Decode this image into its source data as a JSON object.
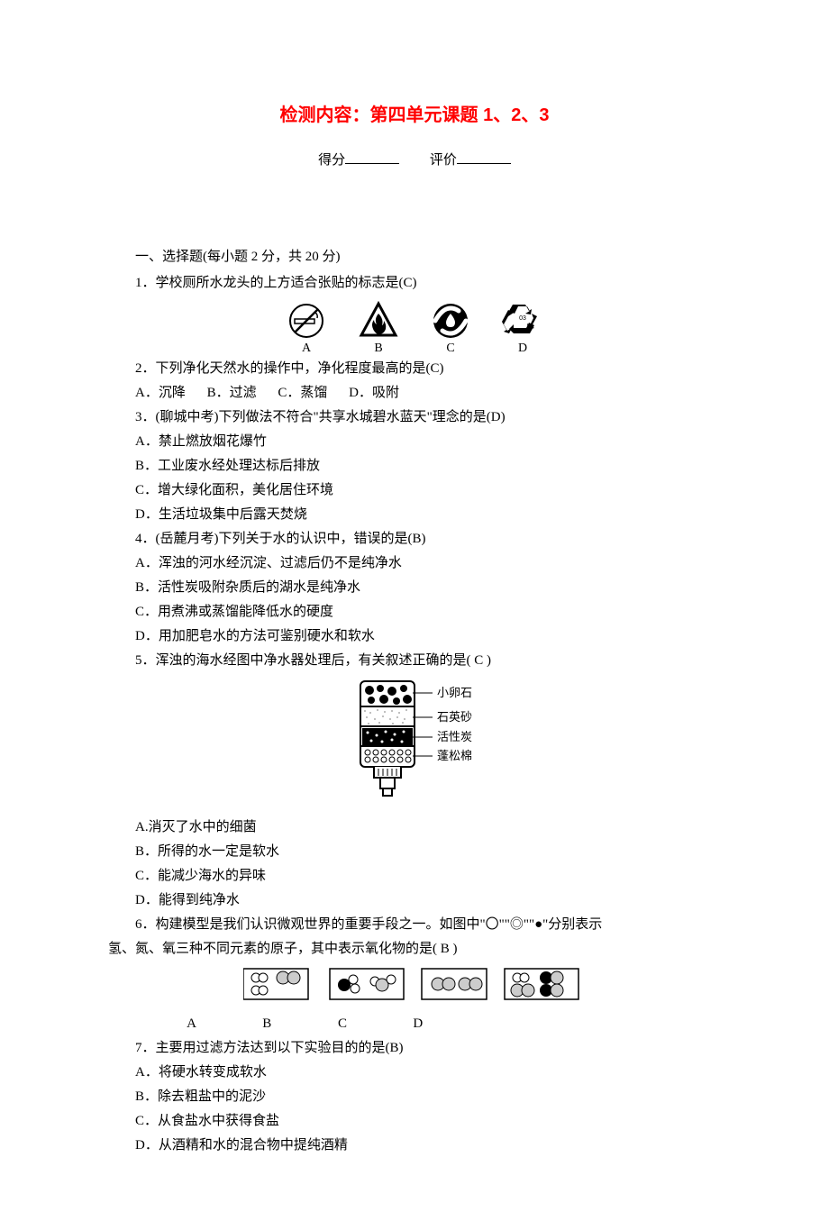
{
  "title": "检测内容：第四单元课题 1、2、3",
  "score_row": {
    "score_label": "得分",
    "eval_label": "评价"
  },
  "section1_head": "一、选择题(每小题 2 分，共 20 分)",
  "q1": {
    "text": "1．学校厕所水龙头的上方适合张贴的标志是(C)",
    "labels": {
      "a": "A",
      "b": "B",
      "c": "C",
      "d": "D"
    },
    "icon_names": {
      "a": "no-smoking-icon",
      "b": "flammable-icon",
      "c": "water-save-icon",
      "d": "recycle-icon"
    }
  },
  "q2": {
    "text": "2．下列净化天然水的操作中，净化程度最高的是(C)",
    "a": "A．沉降",
    "b": "B．过滤",
    "c": "C．蒸馏",
    "d": "D．吸附"
  },
  "q3": {
    "text": "3．(聊城中考)下列做法不符合\"共享水城碧水蓝天\"理念的是(D)",
    "a": "A．禁止燃放烟花爆竹",
    "b": "B．工业废水经处理达标后排放",
    "c": "C．增大绿化面积，美化居住环境",
    "d": "D．生活垃圾集中后露天焚烧"
  },
  "q4": {
    "text": "4．(岳麓月考)下列关于水的认识中，错误的是(B)",
    "a": "A．浑浊的河水经沉淀、过滤后仍不是纯净水",
    "b": "B．活性炭吸附杂质后的湖水是纯净水",
    "c": "C．用煮沸或蒸馏能降低水的硬度",
    "d": "D．用加肥皂水的方法可鉴别硬水和软水"
  },
  "q5": {
    "text": "5．浑浊的海水经图中净水器处理后，有关叙述正确的是( C )",
    "layers": {
      "l1": "小卵石",
      "l2": "石英砂",
      "l3": "活性炭",
      "l4": "蓬松棉"
    },
    "a": "A.消灭了水中的细菌",
    "b": "B．所得的水一定是软水",
    "c": "C．能减少海水的异味",
    "d": "D．能得到纯净水"
  },
  "q6": {
    "text_l1": "6．构建模型是我们认识微观世界的重要手段之一。如图中\"〇\"\"◎\"\"●\"分别表示",
    "text_l2": "氢、氮、氧三种不同元素的原子，其中表示氧化物的是( B )",
    "labels": {
      "a": "A",
      "b": "B",
      "c": "C",
      "d": "D"
    }
  },
  "q7": {
    "text": "7．主要用过滤方法达到以下实验目的的是(B)",
    "a": "A．将硬水转变成软水",
    "b": "B．除去粗盐中的泥沙",
    "c": "C．从食盐水中获得食盐",
    "d": "D．从酒精和水的混合物中提纯酒精"
  }
}
